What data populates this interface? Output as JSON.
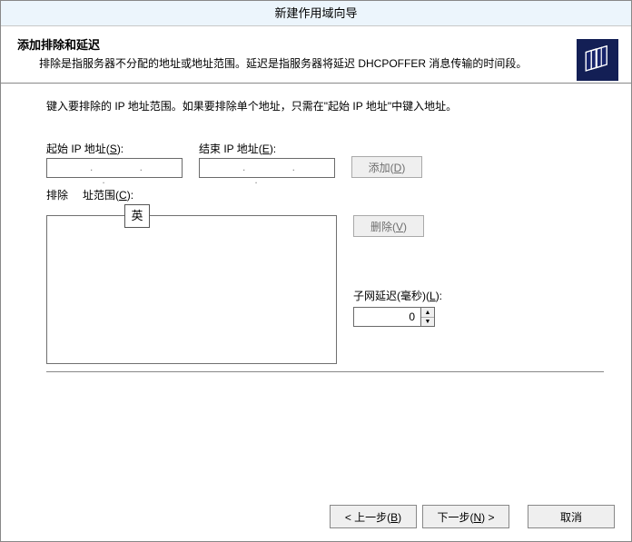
{
  "window": {
    "title": "新建作用域向导"
  },
  "header": {
    "title": "添加排除和延迟",
    "description": "排除是指服务器不分配的地址或地址范围。延迟是指服务器将延迟 DHCPOFFER 消息传输的时间段。"
  },
  "body": {
    "instruction": "键入要排除的 IP 地址范围。如果要排除单个地址，只需在\"起始 IP 地址\"中键入地址。",
    "start_ip_label_prefix": "起始 IP 地址(",
    "start_ip_label_key": "S",
    "start_ip_label_suffix": "):",
    "start_ip_value": "",
    "end_ip_label_prefix": "结束 IP 地址(",
    "end_ip_label_key": "E",
    "end_ip_label_suffix": "):",
    "end_ip_value": "",
    "add_btn_prefix": "添加(",
    "add_btn_key": "D",
    "add_btn_suffix": ")",
    "exclusion_label_prefix": "排除",
    "exclusion_label_mid": "址范围(",
    "exclusion_label_key": "C",
    "exclusion_label_suffix": "):",
    "delete_btn_prefix": "删除(",
    "delete_btn_key": "V",
    "delete_btn_suffix": ")",
    "subnet_delay_label_prefix": "子网延迟(毫秒)(",
    "subnet_delay_label_key": "L",
    "subnet_delay_label_suffix": "):",
    "subnet_delay_value": "0",
    "ime_indicator": "英"
  },
  "footer": {
    "back_prefix": "< 上一步(",
    "back_key": "B",
    "back_suffix": ")",
    "next_prefix": "下一步(",
    "next_key": "N",
    "next_suffix": ") >",
    "cancel": "取消"
  },
  "ip_placeholder_dots": ".   .   ."
}
